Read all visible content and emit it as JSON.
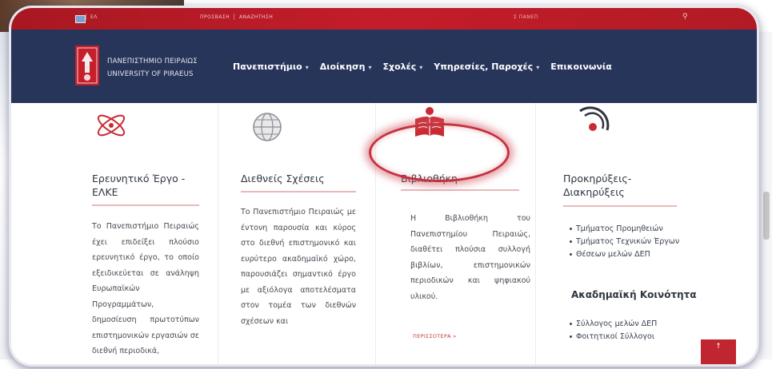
{
  "topbar": {
    "lang_label": "ΕΛ",
    "links": [
      "ΠΡΟΣΒΑΣΗ",
      "ΑΝΑΖΗΤΗΣΗ"
    ],
    "center_text": "Σ ΠΑΝΕΠ"
  },
  "brand": {
    "name_gr": "ΠΑΝΕΠΙΣΤΗΜΙΟ ΠΕΙΡΑΙΩΣ",
    "name_en": "UNIVERSITY OF PIRAEUS",
    "colors": {
      "navbar": "#27355a",
      "topbar": "#c31d2a",
      "accent": "#c4323e"
    }
  },
  "menu": [
    {
      "label": "Πανεπιστήμιο",
      "caret": "▾"
    },
    {
      "label": "Διοίκηση",
      "caret": "▾"
    },
    {
      "label": "Σχολές",
      "caret": "▾"
    },
    {
      "label": "Υπηρεσίες, Παροχές",
      "caret": "▾"
    },
    {
      "label": "Επικοινωνία",
      "caret": ""
    }
  ],
  "columns": [
    {
      "icon": "research-atom-icon",
      "title": "Ερευνητικό Έργο - ΕΛΚΕ",
      "body": "Το Πανεπιστήμιο Πειραιώς έχει επιδείξει πλούσιο ερευνητικό έργο, το οποίο εξειδικεύεται σε ανάληψη Ευρωπαϊκών Προγραμμάτων, δημοσίευση πρωτοτύπων επιστημονικών εργασιών σε διεθνή περιοδικά,"
    },
    {
      "icon": "globe-icon",
      "title": "Διεθνείς Σχέσεις",
      "body": "Το Πανεπιστήμιο Πειραιώς με έντονη παρουσία και κύρος στο διεθνή επιστημονικό και ευρύτερο ακαδημαϊκό χώρο, παρουσιάζει σημαντικό έργο με αξιόλογα αποτελέσματα στον τομέα των διεθνών σχέσεων και"
    },
    {
      "icon": "library-book-icon",
      "title": "Βιβλιοθήκη",
      "body": "Η Βιβλιοθήκη του Πανεπιστημίου Πειραιώς, διαθέτει πλούσια συλλογή βιβλίων, επιστημονικών περιοδικών και ψηφιακού υλικού.",
      "more": "ΠΕΡΙΣΣΟΤΕΡΑ »"
    },
    {
      "icon": "target-rings-icon",
      "title": "Προκηρύξεις- Διακηρύξεις",
      "links": [
        "Τμήματος Προμηθειών",
        "Τμήματος Τεχνικών Έργων",
        "Θέσεων μελών ΔΕΠ"
      ],
      "subtitle": "Ακαδημαϊκή Κοινότητα",
      "links2": [
        "Σύλλογος μελών ΔΕΠ",
        "Φοιτητικοί Σύλλογοι"
      ]
    }
  ],
  "back_to_top": "↑"
}
